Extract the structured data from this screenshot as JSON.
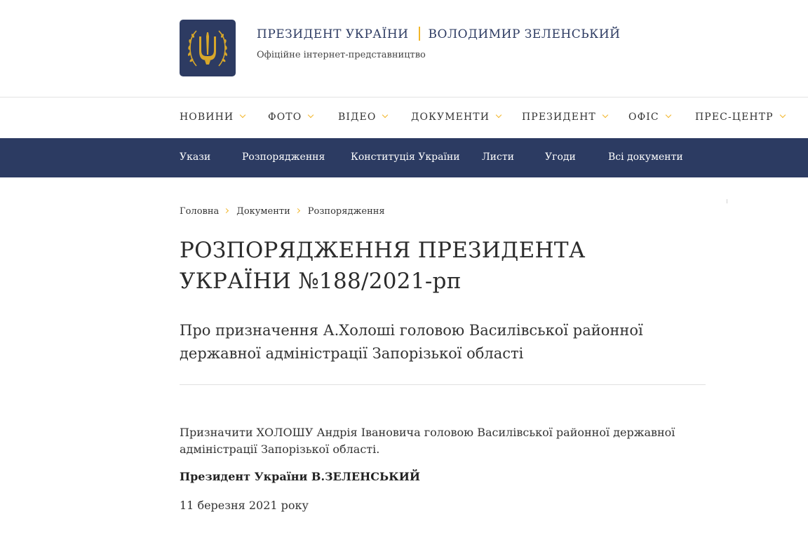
{
  "header": {
    "logo_icon": "trident-coat-of-arms-icon",
    "title_left": "ПРЕЗИДЕНТ УКРАЇНИ",
    "title_right": "ВОЛОДИМИР ЗЕЛЕНСЬКИЙ",
    "subtitle": "Офіційне інтернет-представництво"
  },
  "main_nav": {
    "items": [
      {
        "label": "НОВИНИ"
      },
      {
        "label": "ФОТО"
      },
      {
        "label": "ВІДЕО"
      },
      {
        "label": "ДОКУМЕНТИ"
      },
      {
        "label": "ПРЕЗИДЕНТ"
      },
      {
        "label": "ОФІС"
      },
      {
        "label": "ПРЕС-ЦЕНТР"
      }
    ]
  },
  "sub_nav": {
    "items": [
      {
        "label": "Укази"
      },
      {
        "label": "Розпорядження"
      },
      {
        "label": "Конституція України"
      },
      {
        "label": "Листи"
      },
      {
        "label": "Угоди"
      },
      {
        "label": "Всі документи"
      }
    ]
  },
  "breadcrumb": [
    "Головна",
    "Документи",
    "Розпорядження"
  ],
  "document": {
    "title": "РОЗПОРЯДЖЕННЯ ПРЕЗИДЕНТА УКРАЇНИ №188/2021-рп",
    "subtitle": "Про призначення А.Холоші головою Василівської районної державної адміністрації Запорізької області",
    "body": "Призначити ХОЛОШУ Андрія Івановича головою Василівської районної державної адміністрації Запорізької області.",
    "signature": "Президент України В.ЗЕЛЕНСЬКИЙ",
    "date": "11 березня 2021 року"
  },
  "colors": {
    "navy": "#2c3b62",
    "gold": "#f2b62a"
  }
}
